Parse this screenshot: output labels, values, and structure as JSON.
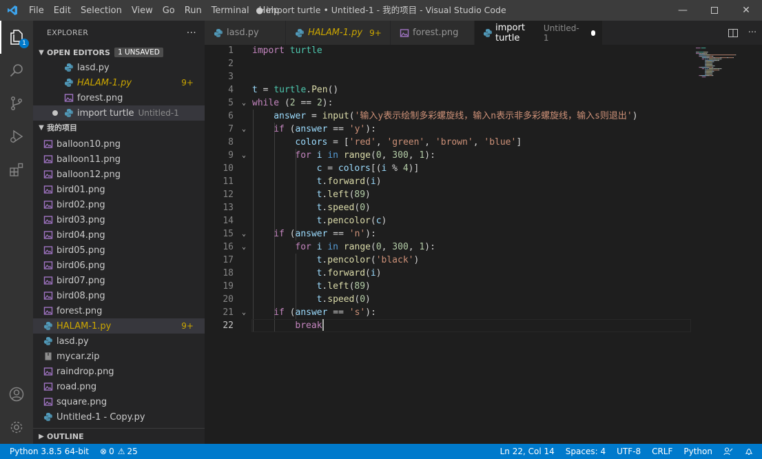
{
  "titlebar": {
    "menu": [
      "File",
      "Edit",
      "Selection",
      "View",
      "Go",
      "Run",
      "Terminal",
      "Help"
    ],
    "window_title": "● import turtle • Untitled-1 - 我的项目 - Visual Studio Code"
  },
  "activity_bar": {
    "explorer_badge": "1",
    "icons": [
      "explorer-icon",
      "search-icon",
      "source-control-icon",
      "run-debug-icon",
      "extensions-icon",
      "account-icon",
      "settings-gear-icon"
    ]
  },
  "sidebar": {
    "title": "EXPLORER",
    "more": "···",
    "open_editors": {
      "label": "OPEN EDITORS",
      "unsaved_badge": "1 UNSAVED",
      "items": [
        {
          "name": "lasd.py",
          "desc": "",
          "count": ""
        },
        {
          "name": "HALAM-1.py",
          "desc": "",
          "count": "9+"
        },
        {
          "name": "forest.png",
          "desc": "",
          "count": ""
        },
        {
          "name": "import turtle",
          "desc": "Untitled-1",
          "count": ""
        }
      ]
    },
    "project": {
      "label": "我的项目",
      "files": [
        {
          "name": "balloon10.png",
          "count": ""
        },
        {
          "name": "balloon11.png",
          "count": ""
        },
        {
          "name": "balloon12.png",
          "count": ""
        },
        {
          "name": "bird01.png",
          "count": ""
        },
        {
          "name": "bird02.png",
          "count": ""
        },
        {
          "name": "bird03.png",
          "count": ""
        },
        {
          "name": "bird04.png",
          "count": ""
        },
        {
          "name": "bird05.png",
          "count": ""
        },
        {
          "name": "bird06.png",
          "count": ""
        },
        {
          "name": "bird07.png",
          "count": ""
        },
        {
          "name": "bird08.png",
          "count": ""
        },
        {
          "name": "forest.png",
          "count": ""
        },
        {
          "name": "HALAM-1.py",
          "count": "9+"
        },
        {
          "name": "lasd.py",
          "count": ""
        },
        {
          "name": "mycar.zip",
          "count": ""
        },
        {
          "name": "raindrop.png",
          "count": ""
        },
        {
          "name": "road.png",
          "count": ""
        },
        {
          "name": "square.png",
          "count": ""
        },
        {
          "name": "Untitled-1 - Copy.py",
          "count": ""
        }
      ]
    },
    "outline_label": "OUTLINE"
  },
  "tabs": [
    {
      "name": "lasd.py",
      "desc": "",
      "count": ""
    },
    {
      "name": "HALAM-1.py",
      "desc": "",
      "count": "9+"
    },
    {
      "name": "forest.png",
      "desc": "",
      "count": ""
    },
    {
      "name": "import turtle",
      "desc": "Untitled-1",
      "count": ""
    }
  ],
  "editor": {
    "current_line": "22",
    "lines": [
      {
        "no": "1",
        "indent": 0,
        "tokens": [
          [
            "k",
            "import"
          ],
          [
            "t",
            " "
          ],
          [
            "m",
            "turtle"
          ]
        ]
      },
      {
        "no": "2",
        "indent": 0,
        "tokens": []
      },
      {
        "no": "3",
        "indent": 0,
        "tokens": []
      },
      {
        "no": "4",
        "indent": 0,
        "tokens": [
          [
            "v",
            "t"
          ],
          [
            "t",
            " = "
          ],
          [
            "m",
            "turtle"
          ],
          [
            "t",
            "."
          ],
          [
            "f",
            "Pen"
          ],
          [
            "t",
            "()"
          ]
        ]
      },
      {
        "no": "5",
        "indent": 0,
        "fold": true,
        "tokens": [
          [
            "k",
            "while"
          ],
          [
            "t",
            " ("
          ],
          [
            "n",
            "2"
          ],
          [
            "t",
            " == "
          ],
          [
            "n",
            "2"
          ],
          [
            "t",
            "):"
          ]
        ]
      },
      {
        "no": "6",
        "indent": 1,
        "tokens": [
          [
            "v",
            "answer"
          ],
          [
            "t",
            " = "
          ],
          [
            "f",
            "input"
          ],
          [
            "t",
            "("
          ],
          [
            "s",
            "'输入y表示绘制多彩螺旋线，输入n表示非多彩螺旋线，输入s则退出'"
          ],
          [
            "t",
            ")"
          ]
        ]
      },
      {
        "no": "7",
        "indent": 1,
        "fold": true,
        "tokens": [
          [
            "k",
            "if"
          ],
          [
            "t",
            " ("
          ],
          [
            "v",
            "answer"
          ],
          [
            "t",
            " == "
          ],
          [
            "s",
            "'y'"
          ],
          [
            "t",
            "):"
          ]
        ]
      },
      {
        "no": "8",
        "indent": 2,
        "tokens": [
          [
            "v",
            "colors"
          ],
          [
            "t",
            " = ["
          ],
          [
            "s",
            "'red'"
          ],
          [
            "t",
            ", "
          ],
          [
            "s",
            "'green'"
          ],
          [
            "t",
            ", "
          ],
          [
            "s",
            "'brown'"
          ],
          [
            "t",
            ", "
          ],
          [
            "s",
            "'blue'"
          ],
          [
            "t",
            "]"
          ]
        ]
      },
      {
        "no": "9",
        "indent": 2,
        "fold": true,
        "tokens": [
          [
            "k",
            "for"
          ],
          [
            "t",
            " "
          ],
          [
            "v",
            "i"
          ],
          [
            "t",
            " "
          ],
          [
            "b",
            "in"
          ],
          [
            "t",
            " "
          ],
          [
            "f",
            "range"
          ],
          [
            "t",
            "("
          ],
          [
            "n",
            "0"
          ],
          [
            "t",
            ", "
          ],
          [
            "n",
            "300"
          ],
          [
            "t",
            ", "
          ],
          [
            "n",
            "1"
          ],
          [
            "t",
            "):"
          ]
        ]
      },
      {
        "no": "10",
        "indent": 3,
        "tokens": [
          [
            "v",
            "c"
          ],
          [
            "t",
            " = "
          ],
          [
            "v",
            "colors"
          ],
          [
            "t",
            "[("
          ],
          [
            "v",
            "i"
          ],
          [
            "t",
            " % "
          ],
          [
            "n",
            "4"
          ],
          [
            "t",
            ")]"
          ]
        ]
      },
      {
        "no": "11",
        "indent": 3,
        "tokens": [
          [
            "v",
            "t"
          ],
          [
            "t",
            "."
          ],
          [
            "f",
            "forward"
          ],
          [
            "t",
            "("
          ],
          [
            "v",
            "i"
          ],
          [
            "t",
            ")"
          ]
        ]
      },
      {
        "no": "12",
        "indent": 3,
        "tokens": [
          [
            "v",
            "t"
          ],
          [
            "t",
            "."
          ],
          [
            "f",
            "left"
          ],
          [
            "t",
            "("
          ],
          [
            "n",
            "89"
          ],
          [
            "t",
            ")"
          ]
        ]
      },
      {
        "no": "13",
        "indent": 3,
        "tokens": [
          [
            "v",
            "t"
          ],
          [
            "t",
            "."
          ],
          [
            "f",
            "speed"
          ],
          [
            "t",
            "("
          ],
          [
            "n",
            "0"
          ],
          [
            "t",
            ")"
          ]
        ]
      },
      {
        "no": "14",
        "indent": 3,
        "tokens": [
          [
            "v",
            "t"
          ],
          [
            "t",
            "."
          ],
          [
            "f",
            "pencolor"
          ],
          [
            "t",
            "("
          ],
          [
            "v",
            "c"
          ],
          [
            "t",
            ")"
          ]
        ]
      },
      {
        "no": "15",
        "indent": 1,
        "fold": true,
        "tokens": [
          [
            "k",
            "if"
          ],
          [
            "t",
            " ("
          ],
          [
            "v",
            "answer"
          ],
          [
            "t",
            " == "
          ],
          [
            "s",
            "'n'"
          ],
          [
            "t",
            "):"
          ]
        ]
      },
      {
        "no": "16",
        "indent": 2,
        "fold": true,
        "tokens": [
          [
            "k",
            "for"
          ],
          [
            "t",
            " "
          ],
          [
            "v",
            "i"
          ],
          [
            "t",
            " "
          ],
          [
            "b",
            "in"
          ],
          [
            "t",
            " "
          ],
          [
            "f",
            "range"
          ],
          [
            "t",
            "("
          ],
          [
            "n",
            "0"
          ],
          [
            "t",
            ", "
          ],
          [
            "n",
            "300"
          ],
          [
            "t",
            ", "
          ],
          [
            "n",
            "1"
          ],
          [
            "t",
            "):"
          ]
        ]
      },
      {
        "no": "17",
        "indent": 3,
        "tokens": [
          [
            "v",
            "t"
          ],
          [
            "t",
            "."
          ],
          [
            "f",
            "pencolor"
          ],
          [
            "t",
            "("
          ],
          [
            "s",
            "'black'"
          ],
          [
            "t",
            ")"
          ]
        ]
      },
      {
        "no": "18",
        "indent": 3,
        "tokens": [
          [
            "v",
            "t"
          ],
          [
            "t",
            "."
          ],
          [
            "f",
            "forward"
          ],
          [
            "t",
            "("
          ],
          [
            "v",
            "i"
          ],
          [
            "t",
            ")"
          ]
        ]
      },
      {
        "no": "19",
        "indent": 3,
        "tokens": [
          [
            "v",
            "t"
          ],
          [
            "t",
            "."
          ],
          [
            "f",
            "left"
          ],
          [
            "t",
            "("
          ],
          [
            "n",
            "89"
          ],
          [
            "t",
            ")"
          ]
        ]
      },
      {
        "no": "20",
        "indent": 3,
        "tokens": [
          [
            "v",
            "t"
          ],
          [
            "t",
            "."
          ],
          [
            "f",
            "speed"
          ],
          [
            "t",
            "("
          ],
          [
            "n",
            "0"
          ],
          [
            "t",
            ")"
          ]
        ]
      },
      {
        "no": "21",
        "indent": 1,
        "fold": true,
        "tokens": [
          [
            "k",
            "if"
          ],
          [
            "t",
            " ("
          ],
          [
            "v",
            "answer"
          ],
          [
            "t",
            " == "
          ],
          [
            "s",
            "'s'"
          ],
          [
            "t",
            "):"
          ]
        ]
      },
      {
        "no": "22",
        "indent": 2,
        "tokens": [
          [
            "k",
            "break"
          ]
        ]
      }
    ]
  },
  "statusbar": {
    "interpreter": "Python 3.8.5 64-bit",
    "errors": "0",
    "warnings": "25",
    "position": "Ln 22, Col 14",
    "spaces": "Spaces: 4",
    "encoding": "UTF-8",
    "eol": "CRLF",
    "language": "Python"
  },
  "colors": {
    "accent": "#007acc",
    "titlebar": "#3c3c3c",
    "sidebar": "#252526",
    "editor": "#1e1e1e",
    "warning": "#cca700"
  }
}
